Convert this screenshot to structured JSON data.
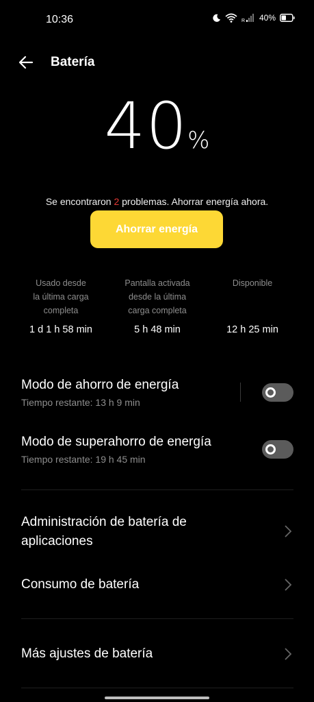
{
  "status": {
    "time": "10:36",
    "battery": "40%",
    "carrier": "R"
  },
  "header": {
    "title": "Batería"
  },
  "battery": {
    "percent": "40",
    "symbol": "%"
  },
  "problems": {
    "prefix": "Se encontraron ",
    "count": "2",
    "suffix": " problemas. Ahorrar energía ahora."
  },
  "save_button": "Ahorrar energía",
  "stats": [
    {
      "label_lines": [
        "Usado desde",
        "la última carga",
        "completa"
      ],
      "value": "1 d 1 h 58 min"
    },
    {
      "label_lines": [
        "Pantalla activada",
        "desde la última",
        "carga completa"
      ],
      "value": "5 h 48 min"
    },
    {
      "label_lines": [
        "Disponible"
      ],
      "value": "12 h 25 min"
    }
  ],
  "power_saving": {
    "title": "Modo de ahorro de energía",
    "subtitle": "Tiempo restante:  13 h 9 min",
    "enabled": false
  },
  "super_saving": {
    "title": "Modo de superahorro de energía",
    "subtitle": "Tiempo restante:  19 h 45 min",
    "enabled": false
  },
  "menu": {
    "app_battery": "Administración de batería de aplicaciones",
    "consumption": "Consumo de batería",
    "more_settings": "Más ajustes de batería"
  },
  "colors": {
    "accent": "#fdd835",
    "warning": "#e53935",
    "background": "#000000",
    "toggle_off": "#5b5b5b"
  }
}
